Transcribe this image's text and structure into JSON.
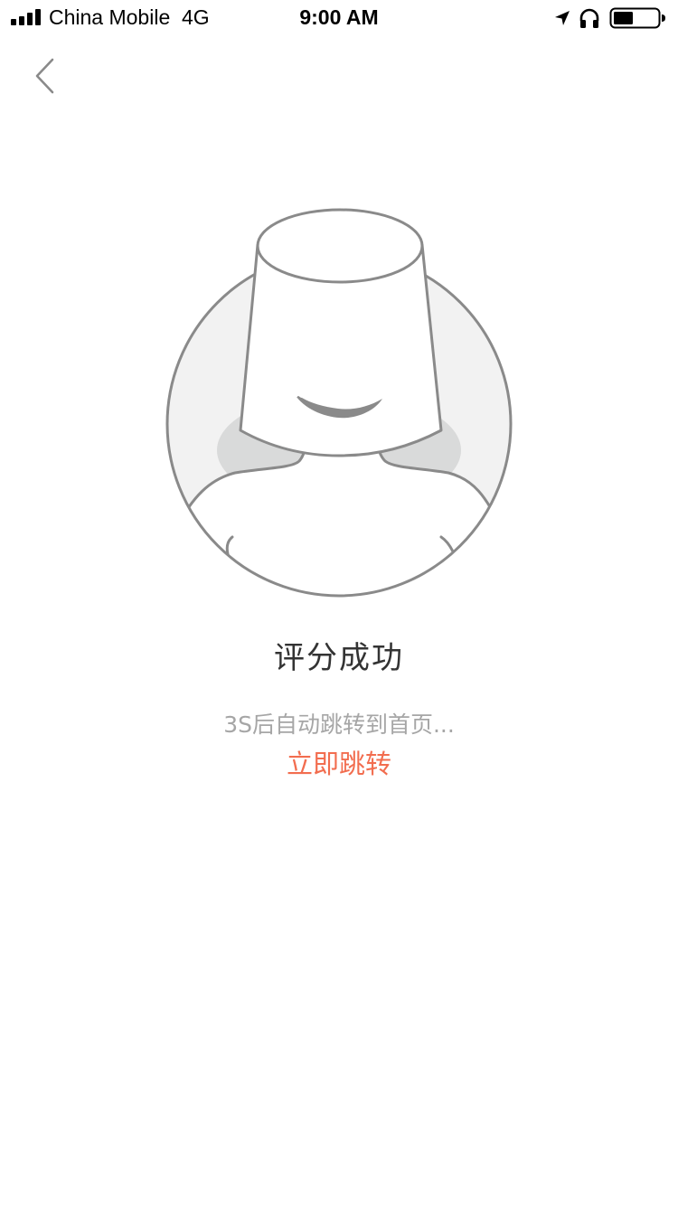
{
  "status_bar": {
    "carrier": "China Mobile  4G",
    "time": "9:00 AM"
  },
  "nav": {
    "back_icon": "chevron-left-icon"
  },
  "illustration": {
    "name": "bucket-hat-face",
    "colors": {
      "stroke": "#8a8a8a",
      "circle_fill": "#f2f2f2",
      "shadow": "#d9dada",
      "body_fill": "#ffffff"
    }
  },
  "content": {
    "title": "评分成功",
    "subtitle": "3S后自动跳转到首页...",
    "jump_label": "立即跳转"
  },
  "colors": {
    "accent": "#f26d4f",
    "title": "#333333",
    "subtitle": "#a6a6a6"
  }
}
